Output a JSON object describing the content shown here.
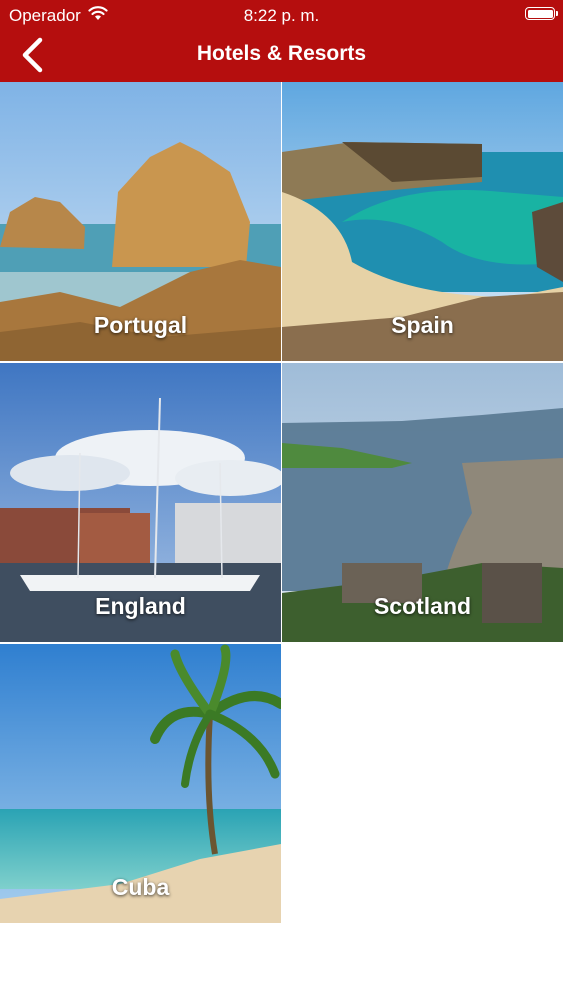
{
  "status_bar": {
    "carrier": "Operador",
    "time": "8:22 p. m.",
    "icons": [
      "wifi-icon",
      "battery-icon"
    ]
  },
  "nav": {
    "title": "Hotels & Resorts",
    "back_icon": "chevron-left-icon"
  },
  "colors": {
    "header_background": "#b50e0e",
    "text": "#ffffff"
  },
  "destinations": [
    {
      "name": "Portugal"
    },
    {
      "name": "Spain"
    },
    {
      "name": "England"
    },
    {
      "name": "Scotland"
    },
    {
      "name": "Cuba"
    }
  ]
}
